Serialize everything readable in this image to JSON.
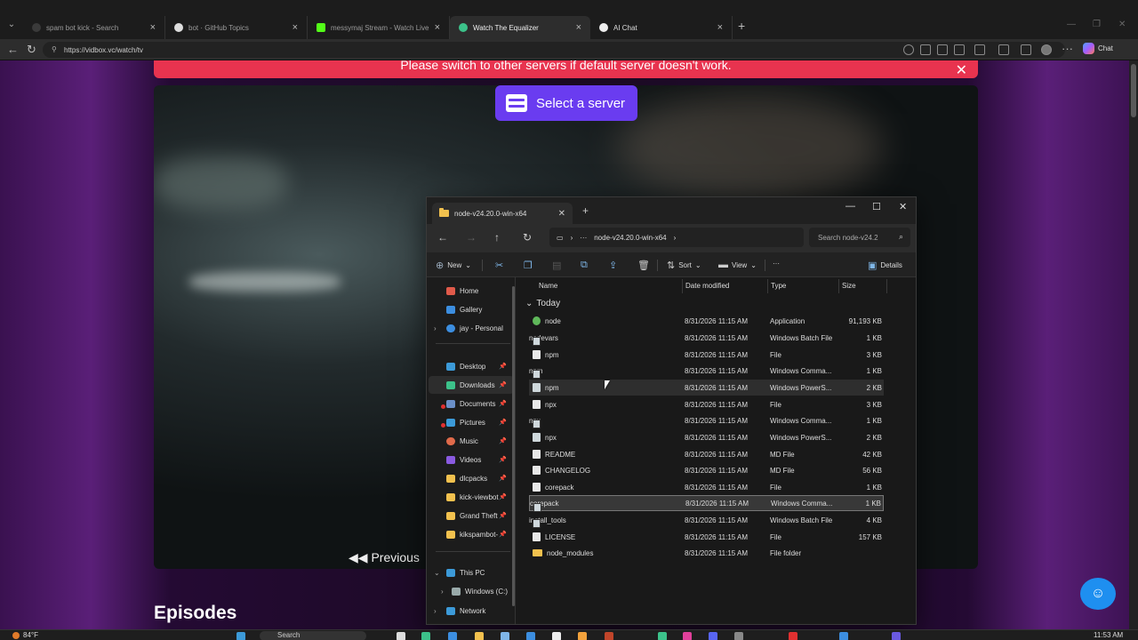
{
  "browser": {
    "tabs": [
      {
        "title": "spam bot kick - Search",
        "active": false
      },
      {
        "title": "bot · GitHub Topics",
        "active": false
      },
      {
        "title": "messymaj Stream - Watch Live on",
        "active": false
      },
      {
        "title": "Watch The Equalizer",
        "active": true
      },
      {
        "title": "AI Chat",
        "active": false
      }
    ],
    "url": "https://vidbox.vc/watch/tv",
    "chat_label": "Chat"
  },
  "page": {
    "banner_text": "Please switch to other servers if default server doesn't work.",
    "server_button": "Select a server",
    "prev_label": "Previous",
    "episodes_heading": "Episodes"
  },
  "explorer": {
    "tab_title": "node-v24.20.0-win-x64",
    "breadcrumb_more": "···",
    "breadcrumb": "node-v24.20.0-win-x64",
    "search_placeholder": "Search node-v24.2",
    "toolbar": {
      "new": "New",
      "sort": "Sort",
      "view": "View",
      "more": "···",
      "details": "Details"
    },
    "columns": {
      "name": "Name",
      "date": "Date modified",
      "type": "Type",
      "size": "Size"
    },
    "group": "Today",
    "sidebar": [
      {
        "label": "Home",
        "icon": "home-icon",
        "color": "#e05a4a"
      },
      {
        "label": "Gallery",
        "icon": "gallery-icon",
        "color": "#3c8ee0"
      },
      {
        "label": "jay - Personal",
        "icon": "onedrive-icon",
        "color": "#3c8ee0"
      },
      {
        "label": "Desktop",
        "icon": "desktop-icon",
        "color": "#3c9ad8"
      },
      {
        "label": "Downloads",
        "icon": "downloads-icon",
        "color": "#3cc28a"
      },
      {
        "label": "Documents",
        "icon": "documents-icon",
        "color": "#6a8fc8"
      },
      {
        "label": "Pictures",
        "icon": "pictures-icon",
        "color": "#3c9ad8"
      },
      {
        "label": "Music",
        "icon": "music-icon",
        "color": "#e06a4a"
      },
      {
        "label": "Videos",
        "icon": "videos-icon",
        "color": "#8a5ae0"
      },
      {
        "label": "dlcpacks",
        "icon": "folder-icon",
        "color": "#f2c14e"
      },
      {
        "label": "kick-viewbot",
        "icon": "folder-icon",
        "color": "#f2c14e"
      },
      {
        "label": "Grand Theft",
        "icon": "folder-icon",
        "color": "#f2c14e"
      },
      {
        "label": "kikspambot-",
        "icon": "folder-icon",
        "color": "#f2c14e"
      },
      {
        "label": "This PC",
        "icon": "this-pc-icon",
        "color": "#3c9ad8"
      },
      {
        "label": "Windows (C:)",
        "icon": "drive-icon",
        "color": "#9aa"
      },
      {
        "label": "Network",
        "icon": "network-icon",
        "color": "#3c9ad8"
      }
    ],
    "files": [
      {
        "name": "node",
        "date": "8/31/2026 11:15 AM",
        "type": "Application",
        "size": "91,193 KB",
        "icon": "app"
      },
      {
        "name": "nodevars",
        "date": "8/31/2026 11:15 AM",
        "type": "Windows Batch File",
        "size": "1 KB",
        "icon": "cmd"
      },
      {
        "name": "npm",
        "date": "8/31/2026 11:15 AM",
        "type": "File",
        "size": "3 KB",
        "icon": "file"
      },
      {
        "name": "npm",
        "date": "8/31/2026 11:15 AM",
        "type": "Windows Comma...",
        "size": "1 KB",
        "icon": "cmd"
      },
      {
        "name": "npm",
        "date": "8/31/2026 11:15 AM",
        "type": "Windows PowerS...",
        "size": "2 KB",
        "icon": "ps"
      },
      {
        "name": "npx",
        "date": "8/31/2026 11:15 AM",
        "type": "File",
        "size": "3 KB",
        "icon": "file"
      },
      {
        "name": "npx",
        "date": "8/31/2026 11:15 AM",
        "type": "Windows Comma...",
        "size": "1 KB",
        "icon": "cmd"
      },
      {
        "name": "npx",
        "date": "8/31/2026 11:15 AM",
        "type": "Windows PowerS...",
        "size": "2 KB",
        "icon": "ps"
      },
      {
        "name": "README",
        "date": "8/31/2026 11:15 AM",
        "type": "MD File",
        "size": "42 KB",
        "icon": "file"
      },
      {
        "name": "CHANGELOG",
        "date": "8/31/2026 11:15 AM",
        "type": "MD File",
        "size": "56 KB",
        "icon": "file"
      },
      {
        "name": "corepack",
        "date": "8/31/2026 11:15 AM",
        "type": "File",
        "size": "1 KB",
        "icon": "file"
      },
      {
        "name": "corepack",
        "date": "8/31/2026 11:15 AM",
        "type": "Windows Comma...",
        "size": "1 KB",
        "icon": "cmd"
      },
      {
        "name": "install_tools",
        "date": "8/31/2026 11:15 AM",
        "type": "Windows Batch File",
        "size": "4 KB",
        "icon": "cmd"
      },
      {
        "name": "LICENSE",
        "date": "8/31/2026 11:15 AM",
        "type": "File",
        "size": "157 KB",
        "icon": "file"
      },
      {
        "name": "node_modules",
        "date": "8/31/2026 11:15 AM",
        "type": "File folder",
        "size": "",
        "icon": "fold"
      }
    ]
  },
  "taskbar": {
    "temp": "84°F",
    "search": "Search",
    "time": "11:53 AM"
  }
}
